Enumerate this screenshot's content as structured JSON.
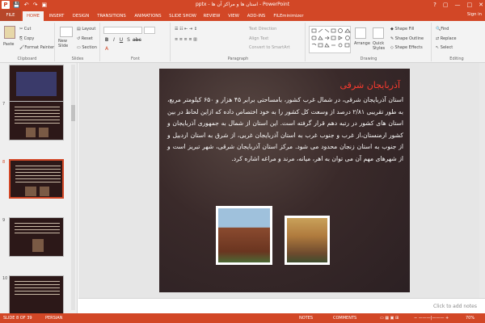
{
  "titlebar": {
    "title": "pptx - استان ها و مراکز آن ها - PowerPoint",
    "app_icon": "P",
    "qat": [
      "save-icon",
      "undo-icon",
      "redo-icon",
      "present-icon"
    ],
    "controls": [
      "?",
      "▢",
      "—",
      "□",
      "✕"
    ]
  },
  "tabs": [
    "FILE",
    "HOME",
    "INSERT",
    "DESIGN",
    "TRANSITIONS",
    "ANIMATIONS",
    "SLIDE SHOW",
    "REVIEW",
    "VIEW",
    "ADD-INS",
    "FILEminimizer"
  ],
  "active_tab": "HOME",
  "signin": "Sign in",
  "ribbon": {
    "clipboard": {
      "paste": "Paste",
      "cut": "Cut",
      "copy": "Copy",
      "format_painter": "Format Painter",
      "label": "Clipboard"
    },
    "slides": {
      "new_slide": "New Slide",
      "layout": "Layout",
      "reset": "Reset",
      "section": "Section",
      "label": "Slides"
    },
    "font": {
      "label": "Font",
      "buttons": [
        "B",
        "I",
        "U",
        "S",
        "abc",
        "AV",
        "Aa",
        "A"
      ]
    },
    "paragraph": {
      "text_direction": "Text Direction",
      "align_text": "Align Text",
      "convert": "Convert to SmartArt",
      "label": "Paragraph"
    },
    "drawing": {
      "arrange": "Arrange",
      "quick_styles": "Quick Styles",
      "shape_fill": "Shape Fill",
      "shape_outline": "Shape Outline",
      "shape_effects": "Shape Effects",
      "label": "Drawing"
    },
    "editing": {
      "find": "Find",
      "replace": "Replace",
      "select": "Select",
      "label": "Editing"
    }
  },
  "thumbnails": [
    {
      "num": "",
      "selected": false
    },
    {
      "num": "7",
      "selected": false
    },
    {
      "num": "8",
      "selected": true
    },
    {
      "num": "9",
      "selected": false
    },
    {
      "num": "10",
      "selected": false
    }
  ],
  "slide": {
    "title": "آذربایجان شرقی",
    "body": "استان آذربایجان شرقی، در شمال غرب کشور، بامساحتی برابر ۴۵ هزار و ۶۵۰ کیلومتر مربع، به طور تقریبی ۲/۸۱ درصد از وسعت کل کشور را به خود اختصاص داده که ازاین لحاظ در بین استان های کشور در رتبه دهم قرار گرفته است. این استان از شمال به جمهوری آذربایجان و کشور ارمنستان،از غرب و جنوب غرب به استان آذربایجان غربی، از شرق به استان اردبیل و از جنوب به استان زنجان محدود می شود. مرکز استان آذربایجان شرقی، شهر تبریز است و از شهرهای مهم آن می توان به اهر، میانه، مرند و مراغه اشاره کرد."
  },
  "notes_placeholder": "Click to add notes",
  "status": {
    "slide": "SLIDE 8 OF 39",
    "language": "PERSIAN",
    "notes": "NOTES",
    "comments": "COMMENTS",
    "zoom": "70%"
  },
  "colors": {
    "accent": "#d24726",
    "title": "#ff3b2f"
  }
}
